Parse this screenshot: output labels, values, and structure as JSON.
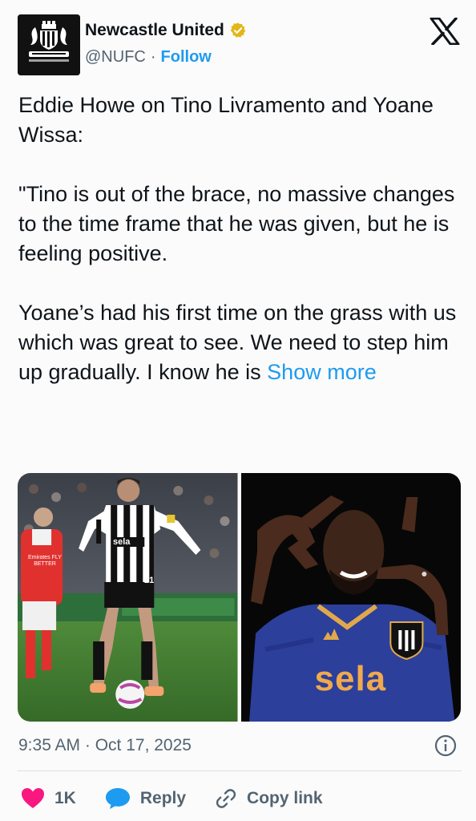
{
  "account": {
    "name": "Newcastle United",
    "handle": "@NUFC",
    "separator": "·",
    "follow_label": "Follow",
    "verified_icon": "verified-badge-icon",
    "avatar_icon": "newcastle-crest"
  },
  "tweet": {
    "paragraph1": "Eddie Howe on Tino Livramento and Yoane Wissa:",
    "paragraph2": "\"Tino is out of the brace, no massive changes to the time frame that he was given, but he is feeling positive.",
    "paragraph3_prefix": "Yoane’s had his first time on the grass with us which was great to see. We need to step him up gradually. I know he is ",
    "show_more": "Show more"
  },
  "media": {
    "photo1": {
      "shirt_sponsor": "sela",
      "arsenal_sponsor": "Emirates FLY BETTER",
      "player_number": "21"
    },
    "photo2": {
      "shirt_sponsor": "sela"
    }
  },
  "meta": {
    "timestamp": "9:35 AM · Oct 17, 2025"
  },
  "actions": {
    "likes": "1K",
    "reply_label": "Reply",
    "copy_link_label": "Copy link"
  },
  "colors": {
    "accent": "#1d9bf0",
    "like": "#f91880",
    "verified": "#e2b719",
    "text": "#0f1419",
    "muted": "#536471"
  }
}
